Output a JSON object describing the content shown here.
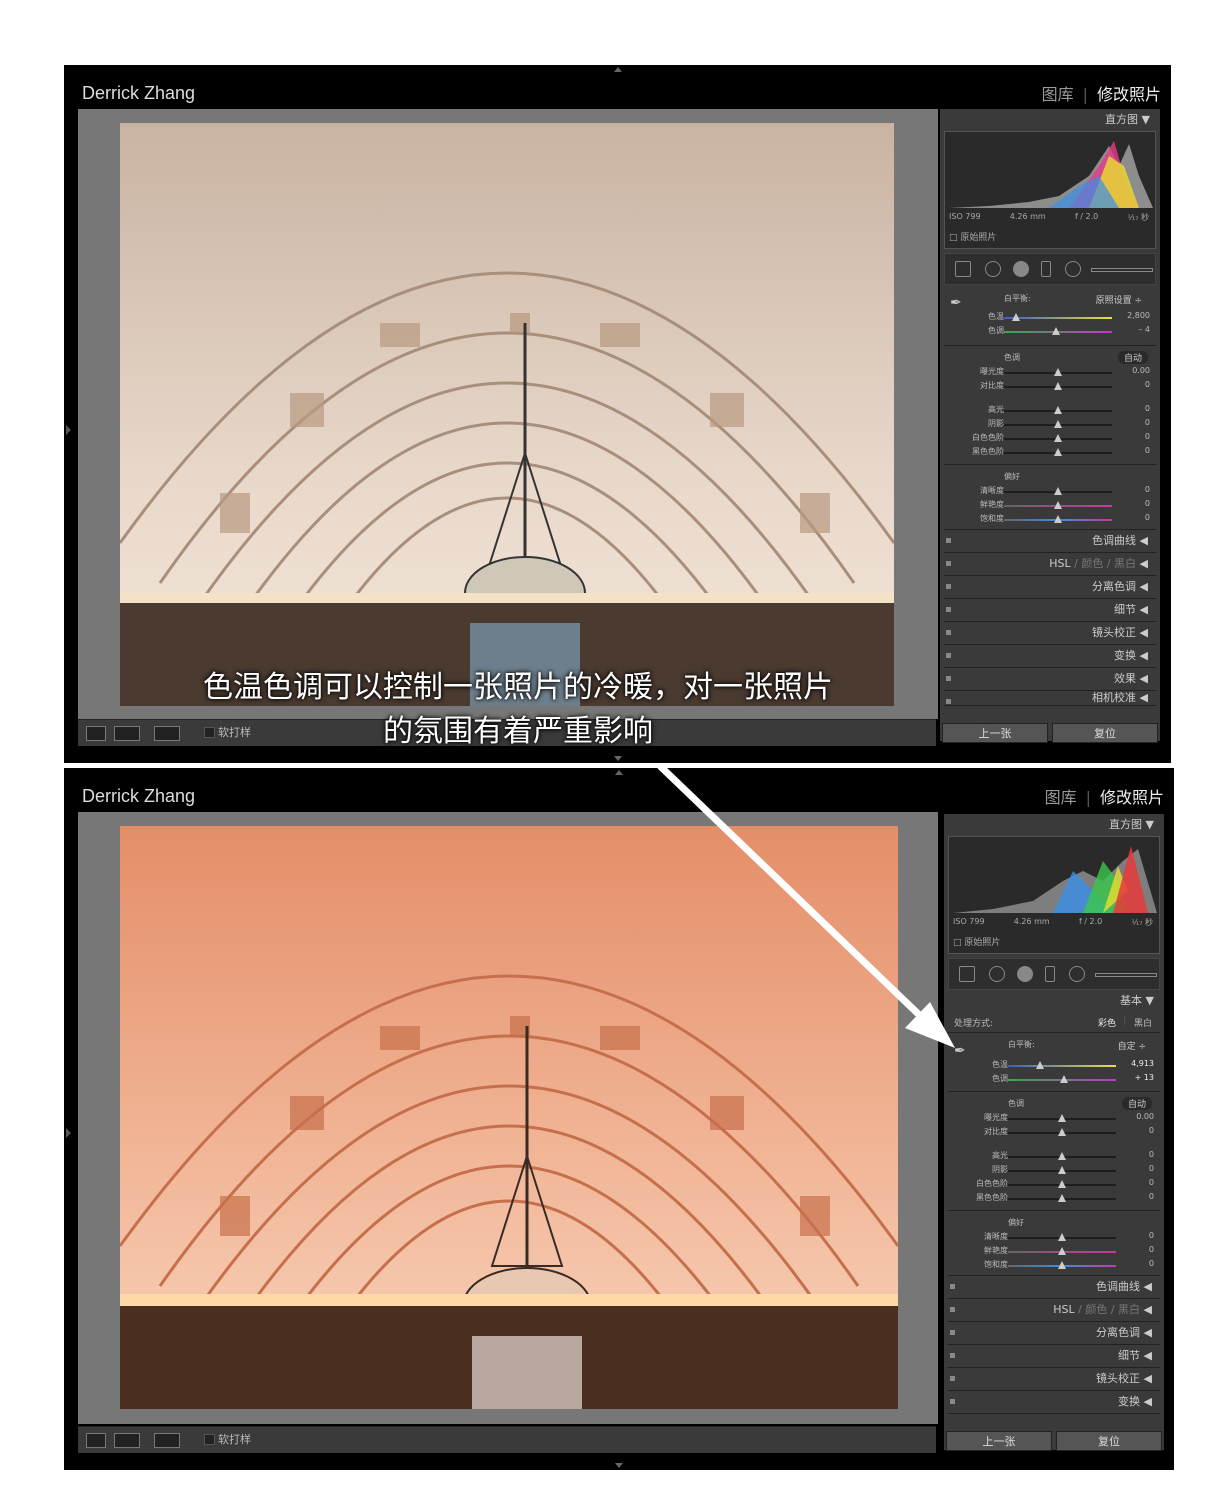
{
  "screens": [
    {
      "brand": "Derrick Zhang",
      "module_library": "图库",
      "module_develop": "修改照片",
      "histogram_label": "直方图",
      "iso": "ISO 799",
      "focal": "4.26 mm",
      "aperture": "f / 2.0",
      "shutter": "¹⁄₁₇ 秒",
      "original_photo": "原始照片",
      "wb_label": "白平衡:",
      "wb_value": "原照设置 ÷",
      "temp_label": "色温",
      "temp_value": "2,800",
      "tint_label": "色调",
      "tint_value": "– 4",
      "tone_label": "色调",
      "auto_label": "自动",
      "exposure_label": "曝光度",
      "exposure_value": "0.00",
      "contrast_label": "对比度",
      "contrast_value": "0",
      "highlights_label": "高光",
      "highlights_value": "0",
      "shadows_label": "阴影",
      "shadows_value": "0",
      "whites_label": "白色色阶",
      "whites_value": "0",
      "blacks_label": "黑色色阶",
      "blacks_value": "0",
      "presence_label": "偏好",
      "clarity_label": "清晰度",
      "clarity_value": "0",
      "vibrance_label": "鲜艳度",
      "vibrance_value": "0",
      "saturation_label": "饱和度",
      "saturation_value": "0",
      "panel_tone_curve": "色调曲线",
      "panel_hsl": "HSL",
      "panel_color": "颜色",
      "panel_bw": "黑白",
      "panel_split": "分离色调",
      "panel_detail": "细节",
      "panel_lens": "镜头校正",
      "panel_transform": "变换",
      "panel_effects": "效果",
      "panel_camera": "相机校准",
      "btn_prev": "上一张",
      "btn_reset": "复位",
      "softproof": "软打样"
    },
    {
      "brand": "Derrick Zhang",
      "module_library": "图库",
      "module_develop": "修改照片",
      "histogram_label": "直方图",
      "iso": "ISO 799",
      "focal": "4.26 mm",
      "aperture": "f / 2.0",
      "shutter": "¹⁄₁₇ 秒",
      "original_photo": "原始照片",
      "basic_label": "基本",
      "treatment_label": "处理方式:",
      "treatment_color": "彩色",
      "treatment_bw": "黑白",
      "wb_label": "白平衡:",
      "wb_value": "自定 ÷",
      "temp_label": "色温",
      "temp_value": "4,913",
      "tint_label": "色调",
      "tint_value": "+ 13",
      "tone_label": "色调",
      "auto_label": "自动",
      "exposure_label": "曝光度",
      "exposure_value": "0.00",
      "contrast_label": "对比度",
      "contrast_value": "0",
      "highlights_label": "高光",
      "highlights_value": "0",
      "shadows_label": "阴影",
      "shadows_value": "0",
      "whites_label": "白色色阶",
      "whites_value": "0",
      "blacks_label": "黑色色阶",
      "blacks_value": "0",
      "presence_label": "偏好",
      "clarity_label": "清晰度",
      "clarity_value": "0",
      "vibrance_label": "鲜艳度",
      "vibrance_value": "0",
      "saturation_label": "饱和度",
      "saturation_value": "0",
      "panel_tone_curve": "色调曲线",
      "panel_hsl": "HSL",
      "panel_color": "颜色",
      "panel_bw": "黑白",
      "panel_split": "分离色调",
      "panel_detail": "细节",
      "panel_lens": "镜头校正",
      "panel_transform": "变换",
      "btn_prev": "上一张",
      "btn_reset": "复位",
      "softproof": "软打样"
    }
  ],
  "caption_line1": "色温色调可以控制一张照片的冷暖，对一张照片",
  "caption_line2": "的氛围有着严重影响",
  "colors": {
    "photo_top_tone": "#d9c4b3",
    "photo_bottom_tone": "#e9a07a"
  }
}
